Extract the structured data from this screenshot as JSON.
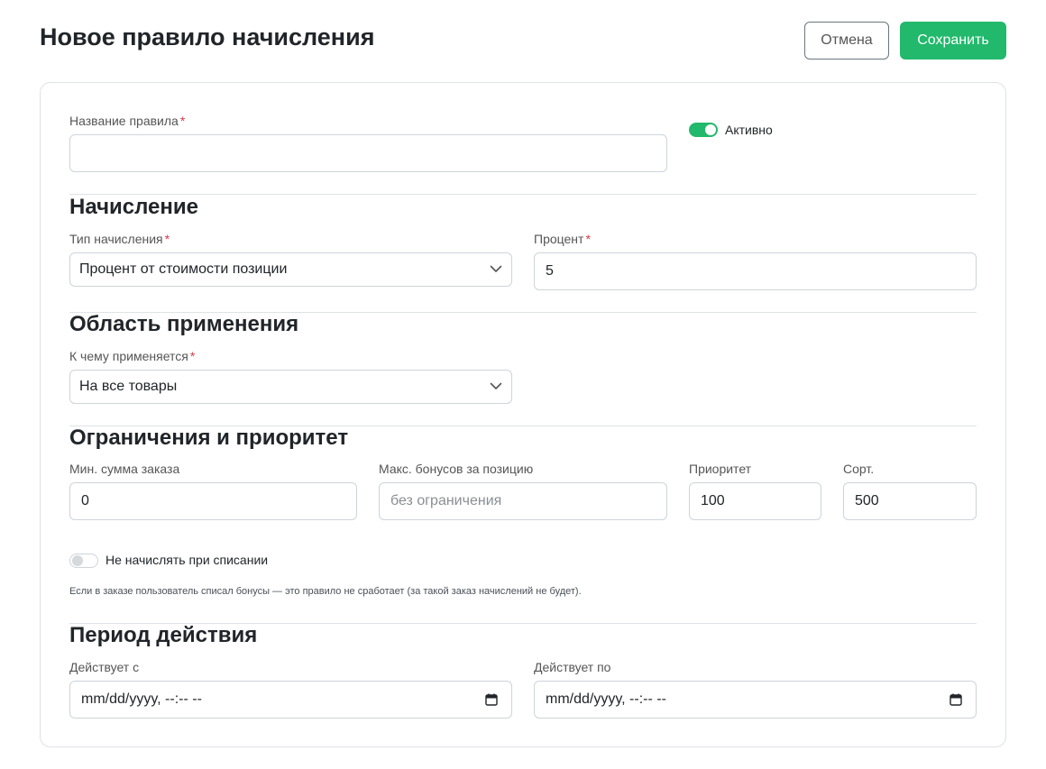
{
  "header": {
    "title": "Новое правило начисления",
    "cancel_label": "Отмена",
    "save_label": "Сохранить"
  },
  "form": {
    "rule_name": {
      "label": "Название правила",
      "required_mark": "*",
      "value": ""
    },
    "active_toggle": {
      "label": "Активно",
      "checked": true
    },
    "accrual": {
      "title": "Начисление",
      "type": {
        "label": "Тип начисления",
        "required_mark": "*",
        "value": "Процент от стоимости позиции"
      },
      "percent": {
        "label": "Процент",
        "required_mark": "*",
        "value": "5"
      }
    },
    "scope": {
      "title": "Область применения",
      "applies_to": {
        "label": "К чему применяется",
        "required_mark": "*",
        "value": "На все товары"
      }
    },
    "limits": {
      "title": "Ограничения и приоритет",
      "min_order": {
        "label": "Мин. сумма заказа",
        "value": "0"
      },
      "max_bonus": {
        "label": "Макс. бонусов за позицию",
        "placeholder": "без ограничения"
      },
      "priority": {
        "label": "Приоритет",
        "value": "100"
      },
      "sort": {
        "label": "Сорт.",
        "value": "500"
      },
      "no_accrual_on_writeoff": {
        "label": "Не начислять при списании",
        "checked": false,
        "help": "Если в заказе пользователь списал бонусы — это правило не сработает (за такой заказ начислений не будет)."
      }
    },
    "period": {
      "title": "Период действия",
      "from": {
        "label": "Действует с",
        "value": "mm/dd/yyyy, --:-- --"
      },
      "to": {
        "label": "Действует по",
        "value": "mm/dd/yyyy, --:-- --"
      }
    }
  },
  "icons": {
    "select_chevron": "chevron-down-icon",
    "date_picker": "calendar-icon"
  },
  "colors": {
    "primary": "#22b96c",
    "required": "#dc3545",
    "border": "#dee2e6"
  }
}
